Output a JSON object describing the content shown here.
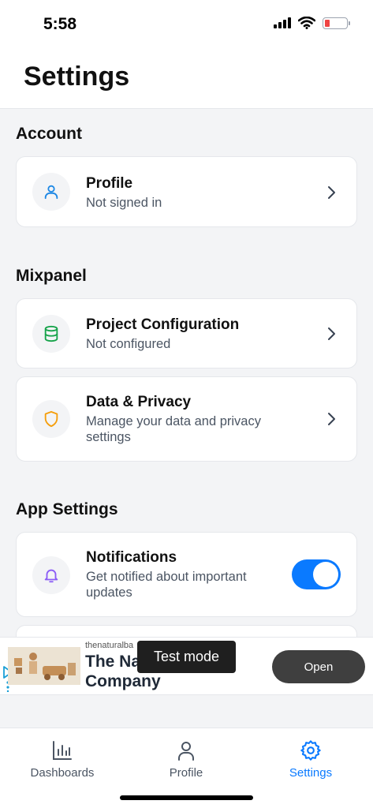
{
  "status_bar": {
    "time": "5:58"
  },
  "header": {
    "title": "Settings"
  },
  "sections": {
    "account": {
      "title": "Account",
      "profile": {
        "title": "Profile",
        "subtitle": "Not signed in",
        "icon": "user-icon",
        "color": "#1e88e5"
      }
    },
    "mixpanel": {
      "title": "Mixpanel",
      "project": {
        "title": "Project Configuration",
        "subtitle": "Not configured",
        "icon": "database-icon",
        "color": "#16a34a"
      },
      "privacy": {
        "title": "Data & Privacy",
        "subtitle": "Manage your data and privacy settings",
        "icon": "shield-icon",
        "color": "#f59e0b"
      }
    },
    "app_settings": {
      "title": "App Settings",
      "notifications": {
        "title": "Notifications",
        "subtitle": "Get notified about important updates",
        "icon": "bell-icon",
        "color": "#8b5cf6",
        "enabled": true
      }
    }
  },
  "ad": {
    "source": "thenaturalba",
    "headline": "The Na Company",
    "open_label": "Open",
    "toast": "Test mode"
  },
  "tabbar": {
    "tabs": [
      {
        "label": "Dashboards",
        "icon": "bar-chart-icon",
        "active": false
      },
      {
        "label": "Profile",
        "icon": "person-icon",
        "active": false
      },
      {
        "label": "Settings",
        "icon": "gear-icon",
        "active": true
      }
    ]
  },
  "colors": {
    "accent": "#0a7aff",
    "background": "#f3f4f6"
  }
}
